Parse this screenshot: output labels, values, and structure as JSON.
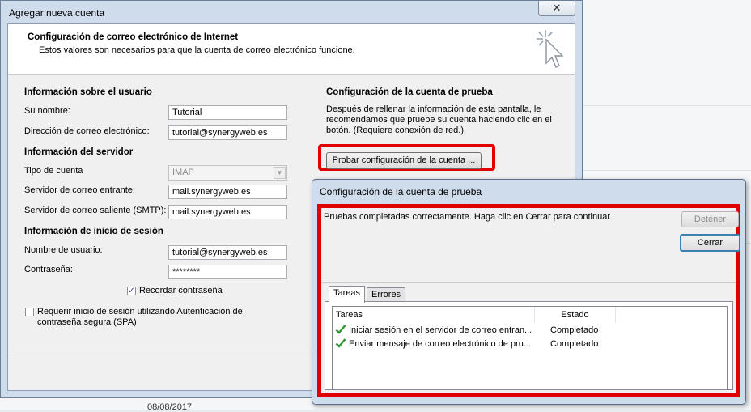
{
  "main_window": {
    "title": "Agregar nueva cuenta",
    "close_glyph": "✕",
    "header": {
      "title": "Configuración de correo electrónico de Internet",
      "subtitle": "Estos valores son necesarios para que la cuenta de correo electrónico funcione."
    },
    "user_info": {
      "section_title": "Información sobre el usuario",
      "name_label": "Su nombre:",
      "name_value": "Tutorial",
      "email_label": "Dirección de correo electrónico:",
      "email_value": "tutorial@synergyweb.es"
    },
    "server_info": {
      "section_title": "Información del servidor",
      "account_type_label": "Tipo de cuenta",
      "account_type_value": "IMAP",
      "incoming_label": "Servidor de correo entrante:",
      "incoming_value": "mail.synergyweb.es",
      "outgoing_label": "Servidor de correo saliente (SMTP):",
      "outgoing_value": "mail.synergyweb.es"
    },
    "logon_info": {
      "section_title": "Información de inicio de sesión",
      "username_label": "Nombre de usuario:",
      "username_value": "tutorial@synergyweb.es",
      "password_label": "Contraseña:",
      "password_value": "********",
      "remember_label": "Recordar contraseña",
      "remember_checked": true,
      "spa_label_line1": "Requerir inicio de sesión utilizando Autenticación de",
      "spa_label_line2": "contraseña segura (SPA)",
      "spa_checked": false
    },
    "test_settings": {
      "section_title": "Configuración de la cuenta de prueba",
      "description": "Después de rellenar la información de esta pantalla, le recomendamos que pruebe su cuenta haciendo clic en el botón. (Requiere conexión de red.)",
      "test_button_label": "Probar configuración de la cuenta ..."
    }
  },
  "test_dialog": {
    "title": "Configuración de la cuenta de prueba",
    "message": "Pruebas completadas correctamente. Haga clic en Cerrar para continuar.",
    "stop_button": "Detener",
    "close_button": "Cerrar",
    "tabs": [
      {
        "label": "Tareas",
        "active": true
      },
      {
        "label": "Errores",
        "active": false
      }
    ],
    "columns": [
      "Tareas",
      "Estado"
    ],
    "rows": [
      {
        "task": "Iniciar sesión en el servidor de correo entran...",
        "status": "Completado"
      },
      {
        "task": "Enviar mensaje de correo electrónico de pru...",
        "status": "Completado"
      }
    ]
  },
  "background": {
    "date_text": "08/08/2017"
  },
  "colors": {
    "highlight_red": "#e00000",
    "window_frame": "#cfdcec",
    "check_green": "#2e9a2e"
  }
}
